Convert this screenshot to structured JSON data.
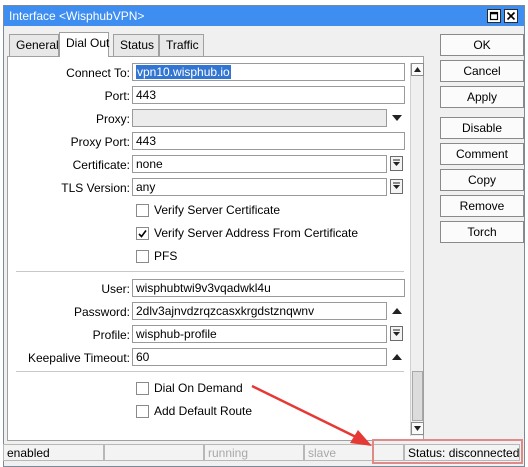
{
  "window": {
    "title": "Interface <WisphubVPN>"
  },
  "tabs": [
    "General",
    "Dial Out",
    "Status",
    "Traffic"
  ],
  "fields": {
    "connect_to": {
      "label": "Connect To:",
      "value": "vpn10.wisphub.io"
    },
    "port": {
      "label": "Port:",
      "value": "443"
    },
    "proxy": {
      "label": "Proxy:",
      "value": ""
    },
    "proxy_port": {
      "label": "Proxy Port:",
      "value": "443"
    },
    "certificate": {
      "label": "Certificate:",
      "value": "none"
    },
    "tls_version": {
      "label": "TLS Version:",
      "value": "any"
    },
    "user": {
      "label": "User:",
      "value": "wisphubtwi9v3vqadwkl4u"
    },
    "password": {
      "label": "Password:",
      "value": "2dlv3ajnvdzrqzcasxkrgdstznqwnv"
    },
    "profile": {
      "label": "Profile:",
      "value": "wisphub-profile"
    },
    "keepalive": {
      "label": "Keepalive Timeout:",
      "value": "60"
    }
  },
  "checkboxes": {
    "verify_server_cert": {
      "label": "Verify Server Certificate",
      "checked": false
    },
    "verify_server_address": {
      "label": "Verify Server Address From Certificate",
      "checked": true
    },
    "pfs": {
      "label": "PFS",
      "checked": false
    },
    "dial_on_demand": {
      "label": "Dial On Demand",
      "checked": false
    },
    "add_default_route": {
      "label": "Add Default Route",
      "checked": false
    }
  },
  "buttons": [
    "OK",
    "Cancel",
    "Apply",
    "Disable",
    "Comment",
    "Copy",
    "Remove",
    "Torch"
  ],
  "status_bar": {
    "enabled": "enabled",
    "blank": "",
    "running": "running",
    "slave": "slave",
    "status": "Status: disconnected"
  },
  "colors": {
    "titlebar": "#3d8ef0",
    "highlight": "#3276d2",
    "annotation": "#e53935"
  }
}
